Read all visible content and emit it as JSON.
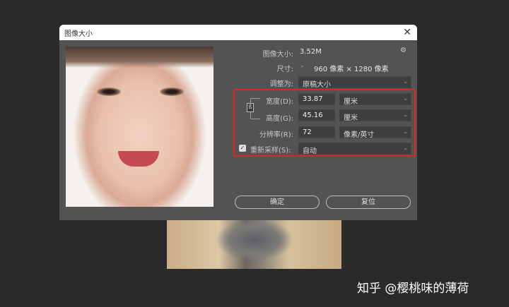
{
  "dialog": {
    "title": "图像大小",
    "close": "✕"
  },
  "info": {
    "image_size_label": "图像大小:",
    "image_size_value": "3.52M",
    "dims_label": "尺寸:",
    "dims_value": "960 像素  ×  1280 像素",
    "fit_label": "调整为:",
    "fit_value": "原稿大小"
  },
  "fields": {
    "width_label": "宽度(D):",
    "width_value": "33.87",
    "width_unit": "厘米",
    "height_label": "高度(G):",
    "height_value": "45.16",
    "height_unit": "厘米",
    "res_label": "分辨率(R):",
    "res_value": "72",
    "res_unit": "像素/英寸",
    "resample_label": "重新采样(S):",
    "resample_value": "自动",
    "resample_checked": true
  },
  "buttons": {
    "ok": "确定",
    "reset": "复位"
  },
  "watermark": "知乎 @樱桃味的薄荷",
  "colors": {
    "highlight": "#e0241f"
  }
}
